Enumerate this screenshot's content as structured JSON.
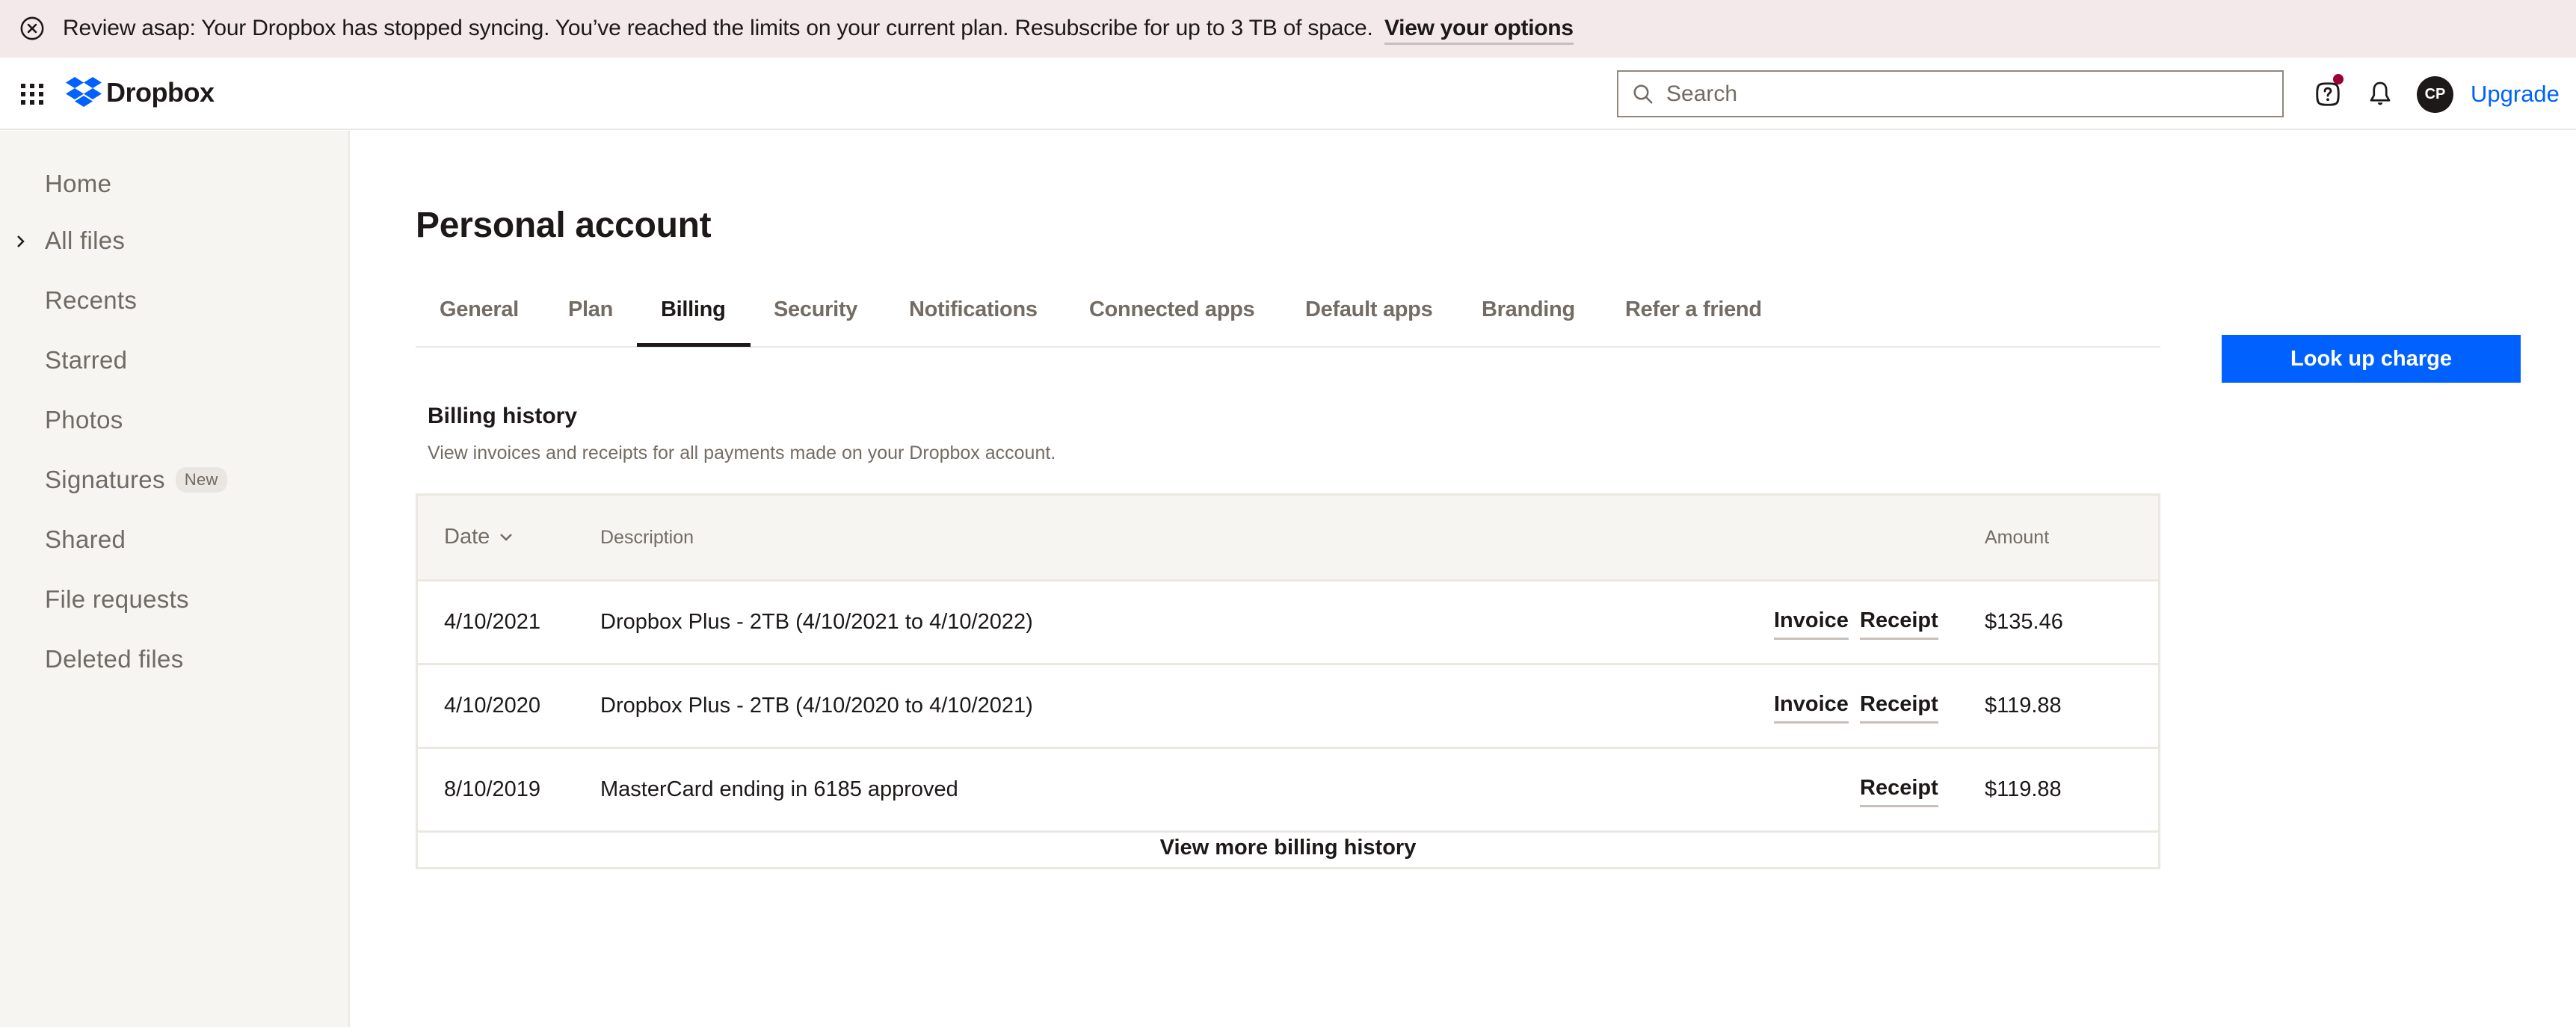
{
  "banner": {
    "icon": "close-circle-icon",
    "message": "Review asap: Your Dropbox has stopped syncing. You’ve reached the limits on your current plan. Resubscribe for up to 3 TB of space.",
    "link_label": "View your options",
    "background": "#f3e8ea"
  },
  "header": {
    "app_grid_icon": "app-grid-icon",
    "logo_text": "Dropbox",
    "search_placeholder": "Search",
    "search_value": "",
    "help_icon": "help-icon",
    "notifications_icon": "bell-icon",
    "avatar_initials": "CP",
    "upgrade_label": "Upgrade",
    "accent_color": "#0061fe"
  },
  "sidebar": {
    "items": [
      {
        "label": "Home"
      },
      {
        "label": "All files",
        "expandable": true
      },
      {
        "label": "Recents"
      },
      {
        "label": "Starred"
      },
      {
        "label": "Photos"
      },
      {
        "label": "Signatures",
        "badge": "New"
      },
      {
        "label": "Shared"
      },
      {
        "label": "File requests"
      },
      {
        "label": "Deleted files"
      }
    ]
  },
  "main": {
    "title": "Personal account",
    "tabs": [
      {
        "label": "General"
      },
      {
        "label": "Plan"
      },
      {
        "label": "Billing",
        "active": true
      },
      {
        "label": "Security"
      },
      {
        "label": "Notifications"
      },
      {
        "label": "Connected apps"
      },
      {
        "label": "Default apps"
      },
      {
        "label": "Branding"
      },
      {
        "label": "Refer a friend"
      }
    ],
    "lookup_button_label": "Look up charge",
    "billing": {
      "title": "Billing history",
      "subtitle": "View invoices and receipts for all payments made on your Dropbox account.",
      "columns": {
        "date": "Date",
        "description": "Description",
        "amount": "Amount"
      },
      "sort": "date-descending",
      "rows": [
        {
          "date": "4/10/2021",
          "description": "Dropbox Plus - 2TB (4/10/2021 to 4/10/2022)",
          "invoice": "Invoice",
          "receipt": "Receipt",
          "amount": "$135.46"
        },
        {
          "date": "4/10/2020",
          "description": "Dropbox Plus - 2TB (4/10/2020 to 4/10/2021)",
          "invoice": "Invoice",
          "receipt": "Receipt",
          "amount": "$119.88"
        },
        {
          "date": "8/10/2019",
          "description": "MasterCard ending in 6185 approved",
          "invoice": null,
          "receipt": "Receipt",
          "amount": "$119.88"
        }
      ],
      "view_more_label": "View more billing history"
    }
  }
}
